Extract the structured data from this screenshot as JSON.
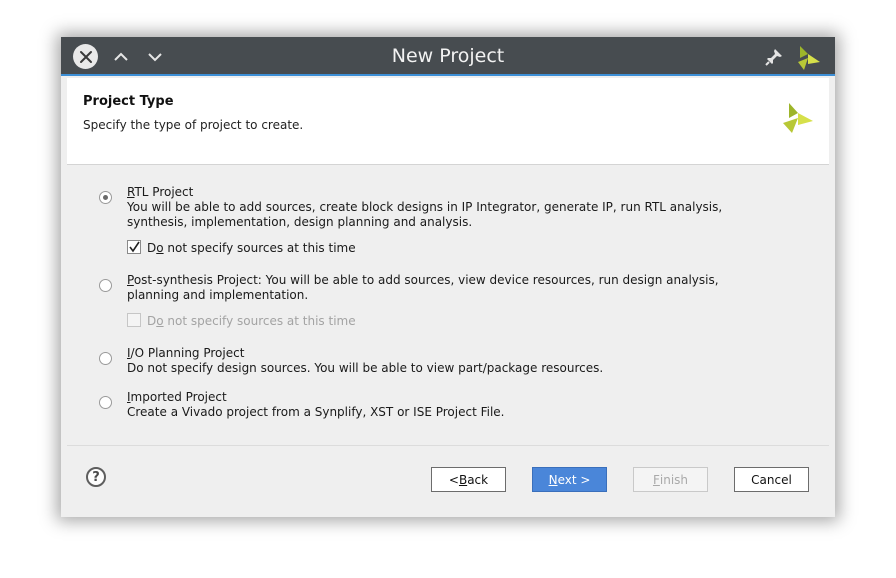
{
  "window": {
    "title": "New Project"
  },
  "titlebar": {
    "close_icon": "close-icon",
    "up_icon": "chevron-up-icon",
    "down_icon": "chevron-down-icon",
    "pin_icon": "pin-icon",
    "logo_icon": "vivado-logo-icon"
  },
  "header": {
    "title": "Project Type",
    "subtitle": "Specify the type of project to create."
  },
  "options": [
    {
      "label_mnemonic": "R",
      "label_rest": "TL Project",
      "description": "You will be able to add sources, create block designs in IP Integrator, generate IP, run RTL analysis, synthesis, implementation, design planning and analysis.",
      "selected": true,
      "checkbox": {
        "pre": "D",
        "mn": "o",
        "post": " not specify sources at this time",
        "checked": true,
        "enabled": true
      }
    },
    {
      "label_mnemonic": "P",
      "label_rest": "ost-synthesis Project:",
      "description": " You will be able to add sources, view device resources, run design analysis, planning and implementation.",
      "selected": false,
      "checkbox": {
        "pre": "D",
        "mn": "o",
        "post": " not specify sources at this time",
        "checked": false,
        "enabled": false
      }
    },
    {
      "label_mnemonic": "I",
      "label_rest": "/O Planning Project",
      "description": "Do not specify design sources. You will be able to view part/package resources.",
      "selected": false
    },
    {
      "label_mnemonic": "I",
      "label_rest": "mported Project",
      "description": "Create a Vivado project from a Synplify, XST or ISE Project File.",
      "selected": false
    }
  ],
  "footer": {
    "help": "?",
    "back": {
      "pre": "< ",
      "mn": "B",
      "post": "ack"
    },
    "next": {
      "mn": "N",
      "post": "ext >"
    },
    "finish": {
      "mn": "F",
      "post": "inish"
    },
    "cancel": "Cancel"
  },
  "colors": {
    "titlebar": "#474c50",
    "accent": "#3d8fd6",
    "primary_button": "#4a86d9",
    "logo_green": "#9db52a",
    "logo_light": "#d6e04a"
  }
}
